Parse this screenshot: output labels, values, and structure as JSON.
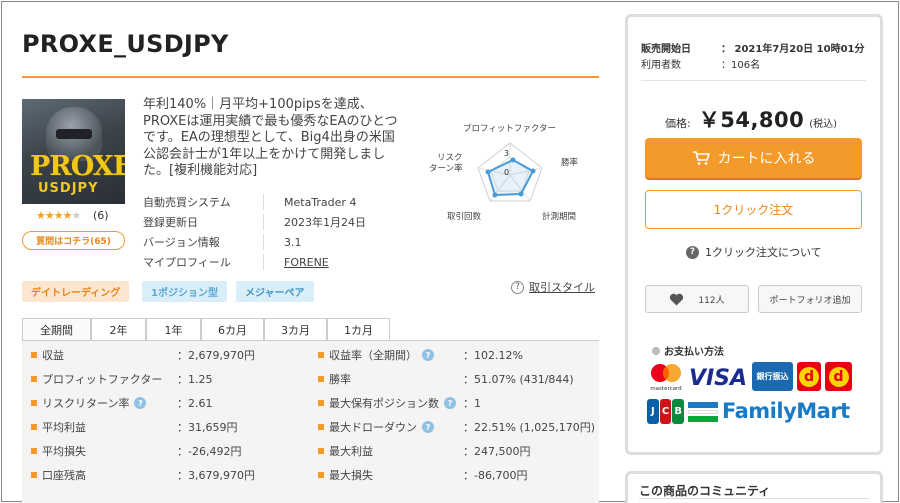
{
  "product": {
    "title": "PROXE_USDJPY",
    "thumbnail_text": "PROXE",
    "thumbnail_subtext": "USDJPY",
    "rating_stars_filled": 4,
    "rating_stars_total": 5,
    "review_count": "(6)",
    "qa_button": "質問はコチラ(65)",
    "description": "年利140%｜月平均+100pipsを達成、PROXEは運用実績で最も優秀なEAのひとつです。EAの理想型として、Big4出身の米国公認会計士が1年以上をかけて開発しました。[複利機能対応]"
  },
  "radar": {
    "labels": {
      "top": "プロフィットファクター",
      "right": "勝率",
      "bottom_right": "計測期間",
      "bottom_left": "取引回数",
      "left_line1": "リスク",
      "left_line2": "ターン率"
    },
    "scale_high": "3",
    "scale_low": "0"
  },
  "specs": [
    {
      "key": "自動売買システム",
      "value": "MetaTrader 4"
    },
    {
      "key": "登録更新日",
      "value": "2023年1月24日"
    },
    {
      "key": "バージョン情報",
      "value": "3.1"
    },
    {
      "key": "マイプロフィール",
      "value": "FORENE"
    }
  ],
  "tags": [
    "デイトレーディング",
    "1ポジション型",
    "メジャーペア"
  ],
  "trade_style": "取引スタイル",
  "tabs": [
    "全期間",
    "2年",
    "1年",
    "6カ月",
    "3カ月",
    "1カ月"
  ],
  "stats_left": [
    {
      "label": "収益",
      "value": "：2,679,970円"
    },
    {
      "label": "プロフィットファクター",
      "value": "：1.25"
    },
    {
      "label": "リスクリターン率",
      "value": "：2.61"
    },
    {
      "label": "平均利益",
      "value": "：31,659円"
    },
    {
      "label": "平均損失",
      "value": "：-26,492円"
    },
    {
      "label": "口座残高",
      "value": "：3,679,970円"
    }
  ],
  "stats_right": [
    {
      "label": "収益率（全期間）",
      "value": "：102.12%"
    },
    {
      "label": "勝率",
      "value": "：51.07% (431/844)"
    },
    {
      "label": "最大保有ポジション数",
      "value": "：1"
    },
    {
      "label": "最大ドローダウン",
      "value": "：22.51% (1,025,170円)"
    },
    {
      "label": "最大利益",
      "value": "：247,500円"
    },
    {
      "label": "最大損失",
      "value": "：-86,700円"
    }
  ],
  "sidebar": {
    "release_label": "販売開始日",
    "release_value": "：  2021年7月20日 10時01分",
    "users_label": "利用者数",
    "users_value": "：106名",
    "price_label": "価格:",
    "price_value": "￥54,800",
    "price_tax": "(税込)",
    "cart_button": "カートに入れる",
    "oneclick_button": "1クリック注文",
    "oneclick_help": "1クリック注文について",
    "favorite_count": "112人",
    "portfolio_button": "ポートフォリオ追加",
    "payment_title": "お支払い方法",
    "pay_mastercard": "mastercard",
    "pay_visa": "VISA",
    "pay_bank": "銀行振込",
    "pay_jcb": [
      "J",
      "C",
      "B"
    ],
    "pay_familymart": "FamilyMart",
    "community_title": "この商品のコミュニティ"
  },
  "colors": {
    "accent": "#f39a2b",
    "tag_blue": "#d9eef8"
  }
}
